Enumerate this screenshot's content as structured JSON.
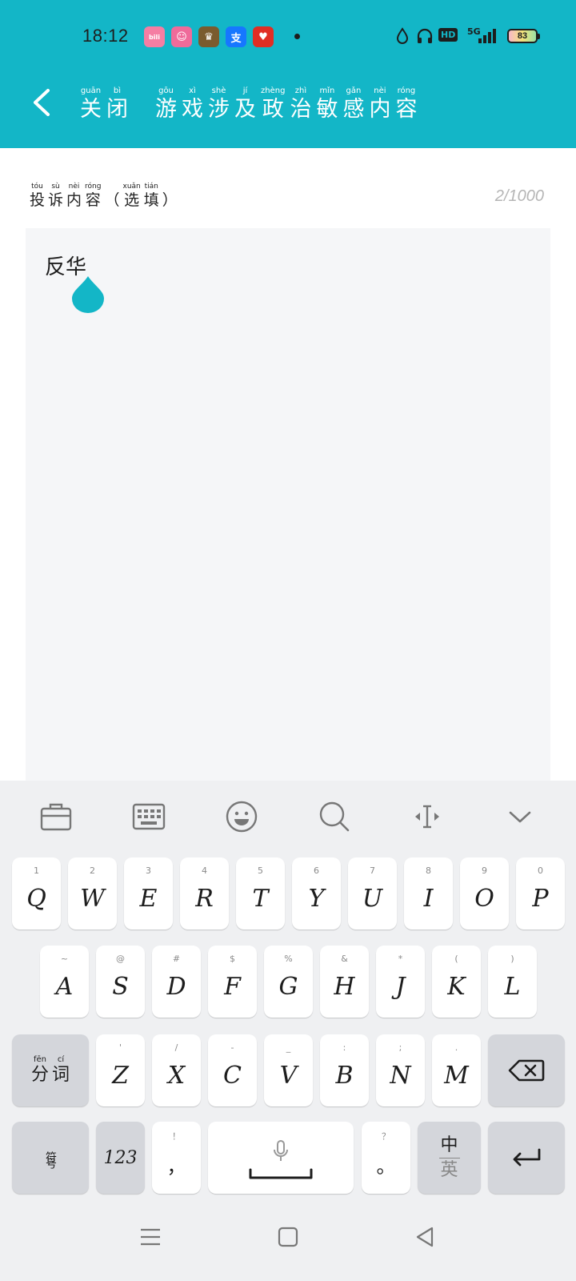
{
  "status_bar": {
    "time": "18:12",
    "network": "5G",
    "hd": "HD",
    "battery": "83",
    "app_icons": [
      "bilibili-icon",
      "pink-app-icon",
      "game-app-icon",
      "alipay-icon",
      "pinduoduo-icon"
    ],
    "alipay_char": "支"
  },
  "header": {
    "close": {
      "chars": [
        "关",
        "闭"
      ],
      "pinyin": [
        "guān",
        "bì"
      ]
    },
    "title": {
      "chars": [
        "游",
        "戏",
        "涉",
        "及",
        "政",
        "治",
        "敏",
        "感",
        "内",
        "容"
      ],
      "pinyin": [
        "gōu",
        "xì",
        "shè",
        "jí",
        "zhèng",
        "zhì",
        "mǐn",
        "gǎn",
        "nèi",
        "róng"
      ]
    }
  },
  "form": {
    "label": {
      "chars": [
        "投",
        "诉",
        "内",
        "容",
        "（",
        "选",
        "填",
        "）"
      ],
      "pinyin": [
        "tóu",
        "sù",
        "nèi",
        "róng",
        "",
        "xuǎn",
        "tián",
        ""
      ]
    },
    "counter": "2/1000",
    "input_value": "反华"
  },
  "keyboard": {
    "row1": [
      {
        "label": "Q",
        "sub": "1"
      },
      {
        "label": "W",
        "sub": "2"
      },
      {
        "label": "E",
        "sub": "3"
      },
      {
        "label": "R",
        "sub": "4"
      },
      {
        "label": "T",
        "sub": "5"
      },
      {
        "label": "Y",
        "sub": "6"
      },
      {
        "label": "U",
        "sub": "7"
      },
      {
        "label": "I",
        "sub": "8"
      },
      {
        "label": "O",
        "sub": "9"
      },
      {
        "label": "P",
        "sub": "0"
      }
    ],
    "row2": [
      {
        "label": "A",
        "sub": "~"
      },
      {
        "label": "S",
        "sub": "@"
      },
      {
        "label": "D",
        "sub": "#"
      },
      {
        "label": "F",
        "sub": "$"
      },
      {
        "label": "G",
        "sub": "%"
      },
      {
        "label": "H",
        "sub": "&"
      },
      {
        "label": "J",
        "sub": "*"
      },
      {
        "label": "K",
        "sub": "("
      },
      {
        "label": "L",
        "sub": ")"
      }
    ],
    "row3": [
      {
        "label": "Z",
        "sub": "'"
      },
      {
        "label": "X",
        "sub": "/"
      },
      {
        "label": "C",
        "sub": "-"
      },
      {
        "label": "V",
        "sub": "_"
      },
      {
        "label": "B",
        "sub": ":"
      },
      {
        "label": "N",
        "sub": ";"
      },
      {
        "label": "M",
        "sub": "."
      }
    ],
    "fenci": {
      "chars": [
        "分",
        "词"
      ],
      "pinyin": [
        "fēn",
        "cí"
      ]
    },
    "symbols": "符号",
    "numbers": "123",
    "comma": "，",
    "comma_sub": "！",
    "period": "。",
    "period_sub": "？",
    "lang_top": "中",
    "lang_bottom": "英"
  }
}
